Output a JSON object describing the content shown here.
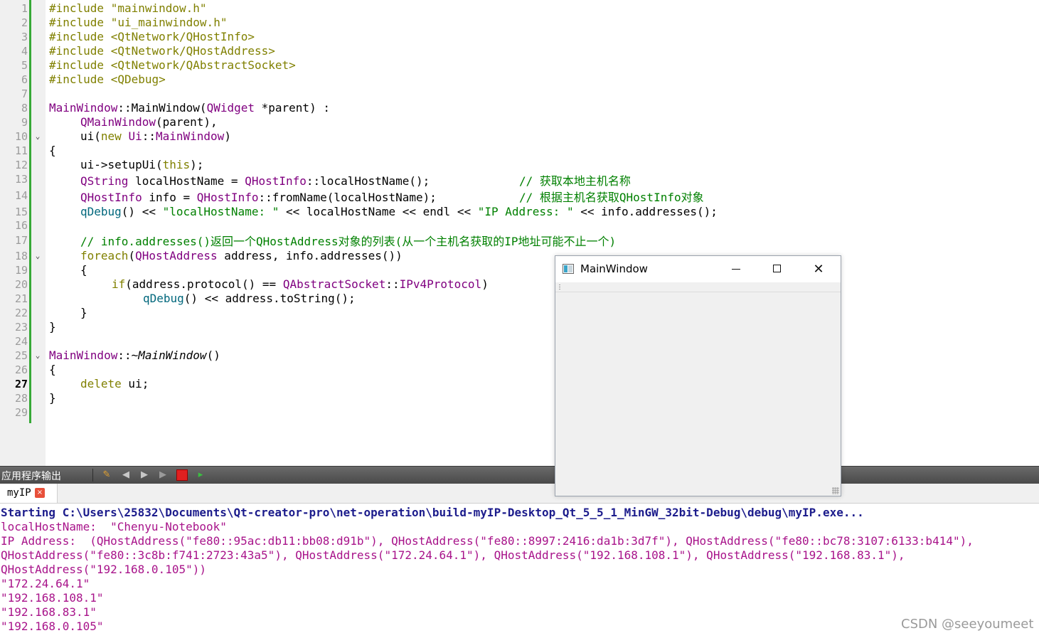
{
  "editor": {
    "line_numbers": [
      "1",
      "2",
      "3",
      "4",
      "5",
      "6",
      "7",
      "8",
      "9",
      "10",
      "11",
      "12",
      "13",
      "14",
      "15",
      "16",
      "17",
      "18",
      "19",
      "20",
      "21",
      "22",
      "23",
      "24",
      "25",
      "26",
      "27",
      "28",
      "29"
    ],
    "current_line": "27",
    "fold_markers": [
      "10",
      "18",
      "25"
    ],
    "code": {
      "l1": "#include \"mainwindow.h\"",
      "l2": "#include \"ui_mainwindow.h\"",
      "l3": "#include <QtNetwork/QHostInfo>",
      "l4": "#include <QtNetwork/QHostAddress>",
      "l5": "#include <QtNetwork/QAbstractSocket>",
      "l6": "#include <QDebug>",
      "l8a": "MainWindow",
      "l8b": "::MainWindow(",
      "l8c": "QWidget",
      "l8d": " *parent) :",
      "l9a": "QMainWindow",
      "l9b": "(parent),",
      "l10a": "ui(",
      "l10b": "new",
      "l10c": " ",
      "l10d": "Ui",
      "l10e": "::",
      "l10f": "MainWindow",
      "l10g": ")",
      "l11": "{",
      "l12a": "ui->setupUi(",
      "l12b": "this",
      "l12c": ");",
      "l13a": "QString",
      "l13b": " localHostName = ",
      "l13c": "QHostInfo",
      "l13d": "::localHostName();",
      "l13e": "// 获取本地主机名称",
      "l14a": "QHostInfo",
      "l14b": " info = ",
      "l14c": "QHostInfo",
      "l14d": "::fromName(localHostName);",
      "l14e": "// 根据主机名获取QHostInfo对象",
      "l15a": "qDebug",
      "l15b": "() << ",
      "l15c": "\"localHostName: \"",
      "l15d": " << localHostName << endl << ",
      "l15e": "\"IP Address: \"",
      "l15f": " << info.addresses();",
      "l17": "// info.addresses()返回一个QHostAddress对象的列表(从一个主机名获取的IP地址可能不止一个)",
      "l18a": "foreach",
      "l18b": "(",
      "l18c": "QHostAddress",
      "l18d": " address, info.addresses())",
      "l19": "{",
      "l20a": "if",
      "l20b": "(address.protocol() == ",
      "l20c": "QAbstractSocket",
      "l20d": "::",
      "l20e": "IPv4Protocol",
      "l20f": ")",
      "l21a": "qDebug",
      "l21b": "() << address.toString();",
      "l22": "}",
      "l23": "}",
      "l25a": "MainWindow",
      "l25b": "::~",
      "l25c": "MainWindow",
      "l25d": "()",
      "l26": "{",
      "l27a": "delete",
      "l27b": " ui;",
      "l28": "}"
    }
  },
  "main_window": {
    "title": "MainWindow",
    "close_glyph": "✕"
  },
  "output_pane": {
    "title": "应用程序输出",
    "toolbar_icons": [
      "clear-icon",
      "previous-icon",
      "next-icon",
      "run-icon",
      "stop-icon",
      "attach-icon"
    ],
    "tab_label": "myIP",
    "tab_close": "×",
    "lines": [
      "Starting C:\\Users\\25832\\Documents\\Qt-creator-pro\\net-operation\\build-myIP-Desktop_Qt_5_5_1_MinGW_32bit-Debug\\debug\\myIP.exe...",
      "localHostName:  \"Chenyu-Notebook\"",
      "IP Address:  (QHostAddress(\"fe80::95ac:db11:bb08:d91b\"), QHostAddress(\"fe80::8997:2416:da1b:3d7f\"), QHostAddress(\"fe80::bc78:3107:6133:b414\"),",
      "QHostAddress(\"fe80::3c8b:f741:2723:43a5\"), QHostAddress(\"172.24.64.1\"), QHostAddress(\"192.168.108.1\"), QHostAddress(\"192.168.83.1\"),",
      "QHostAddress(\"192.168.0.105\"))",
      "\"172.24.64.1\"",
      "\"192.168.108.1\"",
      "\"192.168.83.1\"",
      "\"192.168.0.105\""
    ]
  },
  "watermark": "CSDN @seeyoumeet",
  "colors": {
    "keyword": "#808000",
    "type": "#800080",
    "string": "#008000",
    "comment": "#008000",
    "output_text": "#a8138a",
    "gutter_change_bar": "#36a936"
  }
}
